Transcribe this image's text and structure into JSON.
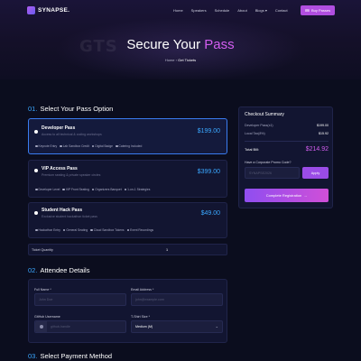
{
  "nav": {
    "logo_text": "SYNAPSE.",
    "links": [
      "Home",
      "Speakers",
      "Schedule",
      "About",
      "Blogs",
      "Contact"
    ],
    "cta_label": "Buy Passes"
  },
  "hero": {
    "background_text": "GTS",
    "title_main": "Secure Your ",
    "title_accent": "Pass",
    "breadcrumb_home": "Home",
    "breadcrumb_current": "Get Tickets"
  },
  "section1": {
    "number": "01.",
    "title": "Select Your Pass Option"
  },
  "passes": [
    {
      "name": "Developer Pass",
      "description": "Access to all technical & coding workshops",
      "price": "$199.00",
      "features": [
        "Keynote Entry",
        "Lab Sandbox Credit",
        "Digital Badge",
        "Catering Included"
      ]
    },
    {
      "name": "VIP Access Pass",
      "description": "Premium seating & private speaker circles",
      "price": "$399.00",
      "features": [
        "Developer Level",
        "VIP Front Seating",
        "Organizers Banquet",
        "1-on-1 Strategies"
      ]
    },
    {
      "name": "Student Hack Pass",
      "description": "Exclusive student hackathon ticket pass",
      "price": "$49.00",
      "features": [
        "Hackathon Entry",
        "General Seating",
        "Cloud Sandbox Tokens",
        "Event Recordings"
      ]
    }
  ],
  "quantity": {
    "label": "Ticket Quantity",
    "value": "1"
  },
  "section2": {
    "number": "02.",
    "title": "Attendee Details"
  },
  "attendee": {
    "full_name_label": "Full Name *",
    "full_name_placeholder": "John Doe",
    "email_label": "Email Address *",
    "email_placeholder": "john@example.com",
    "github_label": "GitHub Username",
    "github_placeholder": "github-handle",
    "tshirt_label": "T-Shirt Size *",
    "tshirt_value": "Medium (M)"
  },
  "section3": {
    "number": "03.",
    "title": "Select Payment Method"
  },
  "summary": {
    "title": "Checkout Summary",
    "rows": [
      {
        "label": "Developer Pass(x1)",
        "value": "$199.00"
      },
      {
        "label": "Local Tax(8%)",
        "value": "$15.92"
      }
    ],
    "total_label": "Total Bill:",
    "total_value": "$214.92",
    "promo_label": "Have a Corporate Promo Code?",
    "promo_placeholder": "SYNAPSE2026",
    "apply_label": "Apply",
    "complete_label": "Complete Registration"
  },
  "colors": {
    "accent_blue": "#3aa7ff",
    "accent_purple": "#d35ef0",
    "button_purple": "#9a4ce6",
    "background": "#0b0d1e"
  }
}
